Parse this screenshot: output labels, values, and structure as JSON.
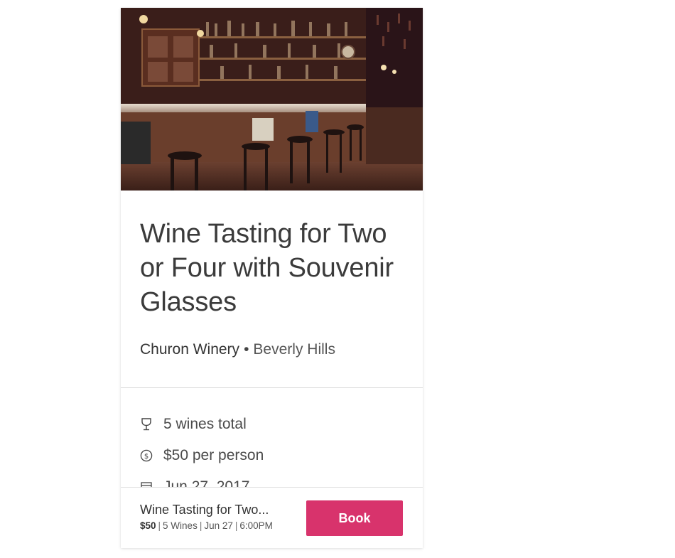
{
  "hero": {
    "image": "bar-interior-photo"
  },
  "event": {
    "title": "Wine Tasting for Two or Four with Souvenir Glasses",
    "venue": "Churon Winery",
    "separator": "•",
    "city": "Beverly Hills"
  },
  "details": [
    {
      "icon": "wine-glass-icon",
      "text": "5 wines total"
    },
    {
      "icon": "dollar-circle-icon",
      "text": "$50 per person"
    },
    {
      "icon": "calendar-icon",
      "text": "Jun 27, 2017"
    }
  ],
  "bottom_bar": {
    "title": "Wine Tasting for Two...",
    "price": "$50",
    "wines": "5 Wines",
    "date": "Jun 27",
    "time": "6:00PM",
    "separator": "|",
    "book_label": "Book"
  },
  "colors": {
    "accent": "#d8336c",
    "text": "#3b3b3b",
    "divider": "#d9d9d9"
  }
}
